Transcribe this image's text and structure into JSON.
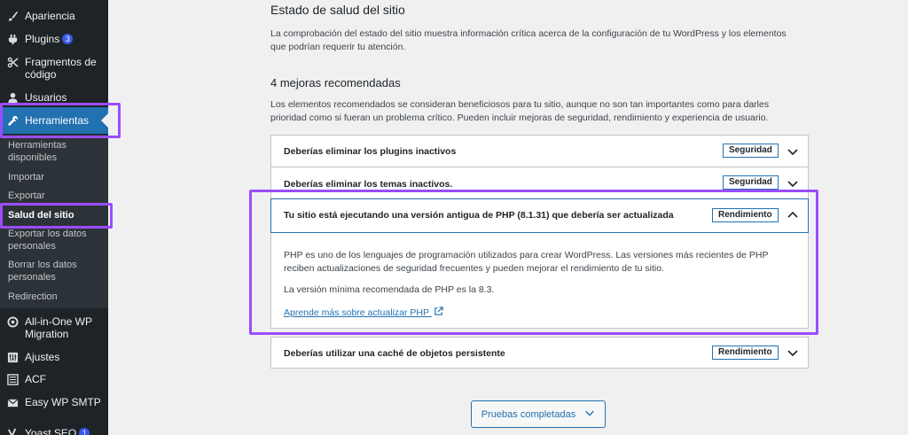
{
  "sidebar": {
    "items": [
      {
        "label": "Apariencia",
        "icon": "paintbrush-icon"
      },
      {
        "label": "Plugins",
        "badge": "3",
        "icon": "plugin-icon"
      },
      {
        "label": "Fragmentos de código",
        "icon": "scissors-icon"
      },
      {
        "label": "Usuarios",
        "icon": "user-icon"
      },
      {
        "label": "Herramientas",
        "icon": "wrench-icon"
      },
      {
        "label": "All-in-One WP Migration",
        "icon": "migration-icon"
      },
      {
        "label": "Ajustes",
        "icon": "sliders-icon"
      },
      {
        "label": "ACF",
        "icon": "acf-icon"
      },
      {
        "label": "Easy WP SMTP",
        "icon": "mail-icon"
      },
      {
        "label": "Yoast SEO",
        "badge": "1",
        "icon": "yoast-icon"
      }
    ],
    "submenu": [
      {
        "label": "Herramientas disponibles"
      },
      {
        "label": "Importar"
      },
      {
        "label": "Exportar"
      },
      {
        "label": "Salud del sitio"
      },
      {
        "label": "Exportar los datos personales"
      },
      {
        "label": "Borrar los datos personales"
      },
      {
        "label": "Redirection"
      }
    ]
  },
  "main": {
    "title": "Estado de salud del sitio",
    "intro": "La comprobación del estado del sitio muestra información crítica acerca de la configuración de tu WordPress y los elementos que podrían requerir tu atención.",
    "recommended_heading": "4 mejoras recomendadas",
    "recommended_desc": "Los elementos recomendados se consideran beneficiosos para tu sitio, aunque no son tan importantes como para darles prioridad como si fueran un problema crítico. Pueden incluir mejoras de seguridad, rendimiento y experiencia de usuario.",
    "issues": [
      {
        "title": "Deberías eliminar los plugins inactivos",
        "tag": "Seguridad",
        "expanded": false
      },
      {
        "title": "Deberías eliminar los temas inactivos.",
        "tag": "Seguridad",
        "expanded": false
      },
      {
        "title": "Tu sitio está ejecutando una versión antigua de PHP (8.1.31) que debería ser actualizada",
        "tag": "Rendimiento",
        "expanded": true,
        "body": "PHP es uno de los lenguajes de programación utilizados para crear WordPress. Las versiones más recientes de PHP reciben actualizaciones de seguridad frecuentes y pueden mejorar el rendimiento de tu sitio.",
        "body2": "La versión mínima recomendada de PHP es la 8.3.",
        "link": "Aprende más sobre actualizar PHP"
      },
      {
        "title": "Deberías utilizar una caché de objetos persistente",
        "tag": "Rendimiento",
        "expanded": false
      }
    ],
    "completed_button": "Pruebas completadas"
  },
  "colors": {
    "accent": "#2271b1",
    "highlight": "#9b4dff",
    "sidebar_bg": "#1d2327"
  }
}
